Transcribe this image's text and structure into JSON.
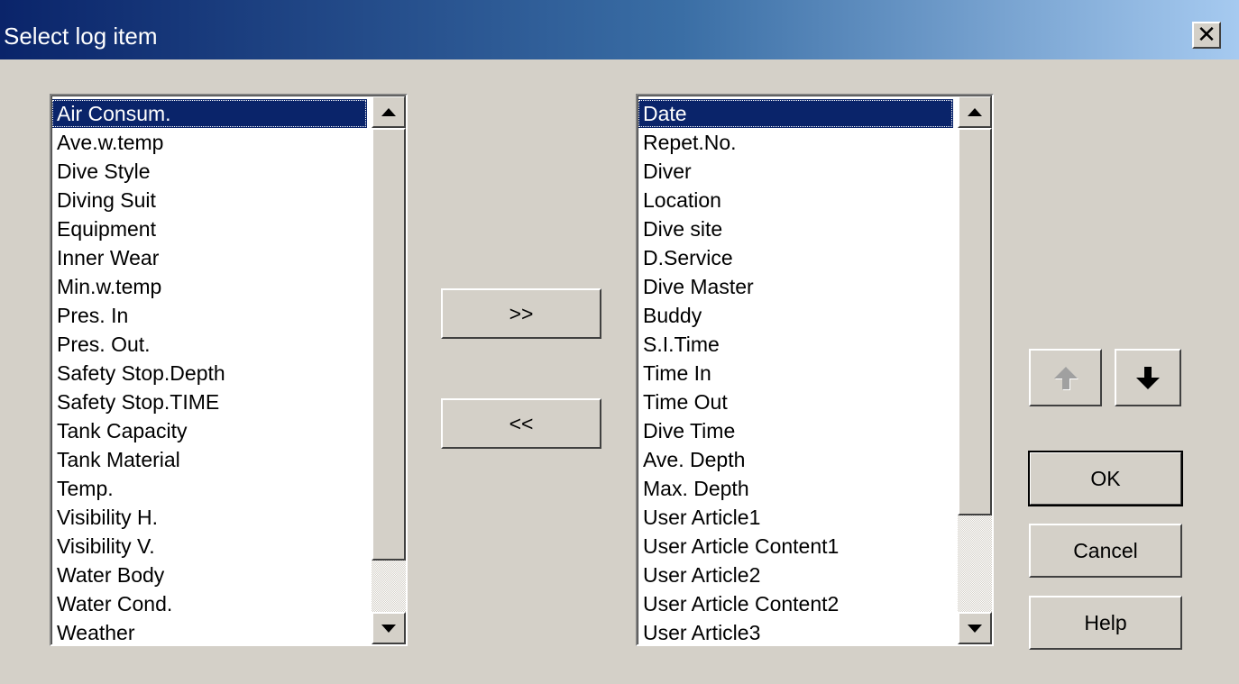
{
  "window": {
    "title": "Select log item",
    "close_icon": "close-icon"
  },
  "available_items": {
    "items": [
      "Air Consum.",
      "Ave.w.temp",
      "Dive Style",
      "Diving Suit",
      "Equipment",
      "Inner Wear",
      "Min.w.temp",
      "Pres. In",
      "Pres. Out.",
      "Safety Stop.Depth",
      "Safety Stop.TIME",
      "Tank Capacity",
      "Tank Material",
      "Temp.",
      "Visibility H.",
      "Visibility V.",
      "Water Body",
      "Water Cond.",
      "Weather"
    ],
    "selected_item": "Air Consum."
  },
  "selected_items": {
    "items": [
      "Date",
      "Repet.No.",
      "Diver",
      "Location",
      "Dive site",
      "D.Service",
      "Dive Master",
      "Buddy",
      "S.I.Time",
      "Time In",
      "Time Out",
      "Dive Time",
      "Ave. Depth",
      "Max. Depth",
      "User Article1",
      "User Article Content1",
      "User Article2",
      "User Article Content2",
      "User Article3"
    ],
    "selected_item": "Date"
  },
  "buttons": {
    "add_label": ">>",
    "remove_label": "<<",
    "move_up_icon": "arrow-up-icon",
    "move_down_icon": "arrow-down-icon",
    "move_up_enabled": false,
    "move_down_enabled": true,
    "ok_label": "OK",
    "cancel_label": "Cancel",
    "help_label": "Help"
  },
  "colors": {
    "selection_background": "#0a246a",
    "selection_text": "#ffffff",
    "dialog_background": "#d4d0c8"
  }
}
